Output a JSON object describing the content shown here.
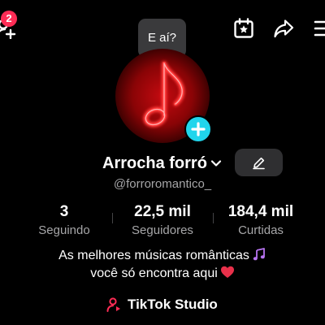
{
  "header": {
    "notification_count": "2",
    "icons": {
      "add_friends": "add-friends-icon",
      "calendar": "calendar-star-icon",
      "share": "share-icon",
      "menu": "menu-icon"
    }
  },
  "status": {
    "text": "E aí?"
  },
  "profile": {
    "avatar_icon": "music-note-icon",
    "name": "Arrocha forró",
    "username": "@forroromantico_"
  },
  "stats": [
    {
      "value": "3",
      "label": "Seguindo"
    },
    {
      "value": "22,5 mil",
      "label": "Seguidores"
    },
    {
      "value": "184,4 mil",
      "label": "Curtidas"
    }
  ],
  "bio": {
    "line1": "As melhores músicas românticas",
    "line1_emoji": "🎶",
    "line2": "você só encontra aqui",
    "line2_emoji": "❤️"
  },
  "studio": {
    "label": "TikTok Studio"
  },
  "colors": {
    "background": "#000000",
    "badge": "#fe2c55",
    "accent_add": "#20d5ec",
    "secondary_text": "#a6a6a8",
    "neon_red": "#ff2a2a"
  }
}
